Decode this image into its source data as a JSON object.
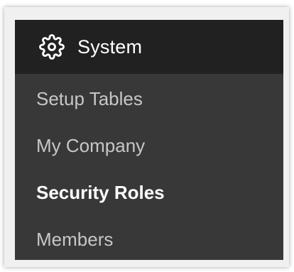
{
  "menu": {
    "header": {
      "icon": "gear-icon",
      "title": "System"
    },
    "items": [
      {
        "label": "Setup Tables",
        "active": false
      },
      {
        "label": "My Company",
        "active": false
      },
      {
        "label": "Security Roles",
        "active": true
      },
      {
        "label": "Members",
        "active": false
      }
    ]
  },
  "colors": {
    "header_bg": "#212121",
    "menu_bg": "#383838",
    "item_text": "#c7c7c7",
    "active_text": "#ffffff"
  }
}
